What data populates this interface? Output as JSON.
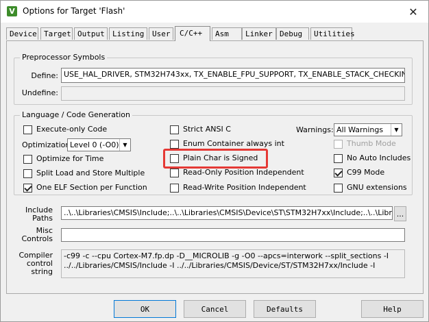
{
  "window": {
    "title": "Options for Target 'Flash'",
    "app_icon": "V",
    "close_glyph": "✕"
  },
  "tabs": [
    "Device",
    "Target",
    "Output",
    "Listing",
    "User",
    "C/C++",
    "Asm",
    "Linker",
    "Debug",
    "Utilities"
  ],
  "preprocessor": {
    "group_label": "Preprocessor Symbols",
    "define_label": "Define:",
    "define_value": "USE_HAL_DRIVER, STM32H743xx, TX_ENABLE_FPU_SUPPORT, TX_ENABLE_STACK_CHECKING",
    "undefine_label": "Undefine:",
    "undefine_value": ""
  },
  "language": {
    "group_label": "Language / Code Generation",
    "execute_only": {
      "label": "Execute-only Code",
      "checked": false
    },
    "optimization_label": "Optimization:",
    "optimization_value": "Level 0 (-O0)",
    "optimize_time": {
      "label": "Optimize for Time",
      "checked": false
    },
    "split_load": {
      "label": "Split Load and Store Multiple",
      "checked": false
    },
    "one_elf": {
      "label": "One ELF Section per Function",
      "checked": true
    },
    "strict_ansi": {
      "label": "Strict ANSI C",
      "checked": false
    },
    "enum_container": {
      "label": "Enum Container always int",
      "checked": false
    },
    "plain_char": {
      "label": "Plain Char is Signed",
      "checked": false
    },
    "ro_pi": {
      "label": "Read-Only Position Independent",
      "checked": false
    },
    "rw_pi": {
      "label": "Read-Write Position Independent",
      "checked": false
    },
    "warnings_label": "Warnings:",
    "warnings_value": "All Warnings",
    "thumb_mode": {
      "label": "Thumb Mode",
      "checked": false
    },
    "no_auto_includes": {
      "label": "No Auto Includes",
      "checked": false
    },
    "c99_mode": {
      "label": "C99 Mode",
      "checked": true
    },
    "gnu_ext": {
      "label": "GNU extensions",
      "checked": false
    }
  },
  "include": {
    "label_line1": "Include",
    "label_line2": "Paths",
    "value": "..\\..\\Libraries\\CMSIS\\Include;..\\..\\Libraries\\CMSIS\\Device\\ST\\STM32H7xx\\Include;..\\..\\Libraries\\S",
    "browse_label": "..."
  },
  "misc": {
    "label_line1": "Misc",
    "label_line2": "Controls",
    "value": ""
  },
  "compiler": {
    "label_line1": "Compiler",
    "label_line2": "control",
    "label_line3": "string",
    "line1": "-c99 -c --cpu Cortex-M7.fp.dp -D__MICROLIB -g -O0 --apcs=interwork --split_sections -I",
    "line2": "../../Libraries/CMSIS/Include -I ../../Libraries/CMSIS/Device/ST/STM32H7xx/Include -I"
  },
  "buttons": {
    "ok": "OK",
    "cancel": "Cancel",
    "defaults": "Defaults",
    "help": "Help"
  },
  "colors": {
    "highlight": "#e53935",
    "icon_bg": "#3d8c2a"
  }
}
